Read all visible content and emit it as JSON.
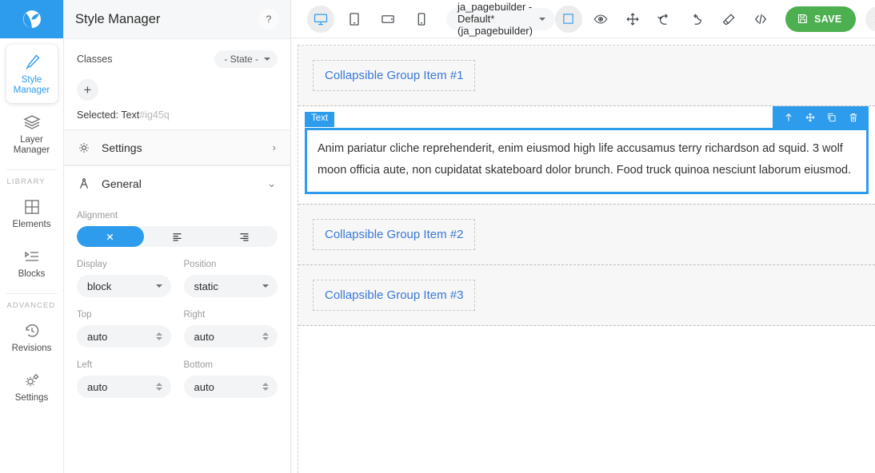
{
  "rail": {
    "logo_icon": "grapesjs-logo-icon",
    "items": [
      {
        "icon": "brush-icon",
        "label": "Style\nManager",
        "label_line1": "Style",
        "label_line2": "Manager",
        "active": true
      },
      {
        "icon": "layers-icon",
        "label_line1": "Layer",
        "label_line2": "Manager",
        "active": false
      },
      {
        "icon": "grid-icon",
        "label_line1": "Elements",
        "label_line2": "",
        "active": false
      },
      {
        "icon": "blocks-list-icon",
        "label_line1": "Blocks",
        "label_line2": "",
        "active": false
      },
      {
        "icon": "revisions-clock-icon",
        "label_line1": "Revisions",
        "label_line2": "",
        "active": false
      },
      {
        "icon": "gears-icon",
        "label_line1": "Settings",
        "label_line2": "",
        "active": false
      }
    ],
    "caption_library": "LIBRARY",
    "caption_advanced": "ADVANCED"
  },
  "panel": {
    "title": "Style Manager",
    "help_label": "?",
    "classes_label": "Classes",
    "state_label": "- State -",
    "add_class_label": "+",
    "selected_prefix": "Selected:",
    "selected_name": "Text",
    "selected_id": "#ig45q",
    "sections": [
      {
        "name": "Settings",
        "icon": "gear-icon",
        "chevron": "›",
        "expanded": false
      },
      {
        "name": "General",
        "icon": "compass-icon",
        "chevron": "⌄",
        "expanded": true
      }
    ],
    "alignment": {
      "label": "Alignment",
      "options": [
        {
          "icon": "none-x-icon",
          "value": "none",
          "active": true
        },
        {
          "icon": "align-left-icon",
          "value": "left",
          "active": false
        },
        {
          "icon": "align-right-icon",
          "value": "right",
          "active": false
        }
      ]
    },
    "display": {
      "label": "Display",
      "value": "block"
    },
    "position": {
      "label": "Position",
      "value": "static"
    },
    "top": {
      "label": "Top",
      "value": "auto"
    },
    "right": {
      "label": "Right",
      "value": "auto"
    },
    "left": {
      "label": "Left",
      "value": "auto"
    },
    "bottom": {
      "label": "Bottom",
      "value": "auto"
    }
  },
  "topbar": {
    "devices": [
      {
        "icon": "desktop-icon",
        "name": "desktop",
        "active": true
      },
      {
        "icon": "tablet-icon",
        "name": "tablet",
        "active": false
      },
      {
        "icon": "tablet-landscape-icon",
        "name": "tablet-landscape",
        "active": false
      },
      {
        "icon": "mobile-icon",
        "name": "mobile",
        "active": false
      }
    ],
    "document_name": "ja_pagebuilder - Default* (ja_pagebuilder)",
    "actions": [
      {
        "icon": "borders-icon",
        "name": "toggle-borders",
        "active": true
      },
      {
        "icon": "eye-icon",
        "name": "preview",
        "active": false
      },
      {
        "icon": "fullscreen-icon",
        "name": "fullscreen",
        "active": false
      },
      {
        "icon": "undo-icon",
        "name": "undo",
        "active": false
      },
      {
        "icon": "redo-icon",
        "name": "redo",
        "active": false
      },
      {
        "icon": "eraser-icon",
        "name": "clear-canvas",
        "active": false
      },
      {
        "icon": "code-icon",
        "name": "view-code",
        "active": false
      }
    ],
    "save_label": "SAVE",
    "save_icon": "floppy-disk-icon",
    "close_icon": "close-icon"
  },
  "canvas": {
    "groups": [
      {
        "title": "Collapsible Group Item #1"
      },
      {
        "title": "Collapsible Group Item #2"
      },
      {
        "title": "Collapsible Group Item #3"
      }
    ],
    "selected_block": {
      "badge": "Text",
      "toolbar": [
        {
          "icon": "arrow-up-icon",
          "name": "select-parent"
        },
        {
          "icon": "move-icon",
          "name": "move-component"
        },
        {
          "icon": "copy-icon",
          "name": "copy-component"
        },
        {
          "icon": "trash-icon",
          "name": "delete-component"
        }
      ],
      "text": "Anim pariatur cliche reprehenderit, enim eiusmod high life accusamus terry richardson ad squid. 3 wolf moon officia aute, non cupidatat skateboard dolor brunch. Food truck quinoa nesciunt laborum eiusmod."
    }
  },
  "colors": {
    "accent_blue": "#2e9ced",
    "save_green": "#4caf50",
    "link_blue": "#3b78d8",
    "panel_bg": "#f6f7f8",
    "field_bg": "#f3f4f5"
  }
}
